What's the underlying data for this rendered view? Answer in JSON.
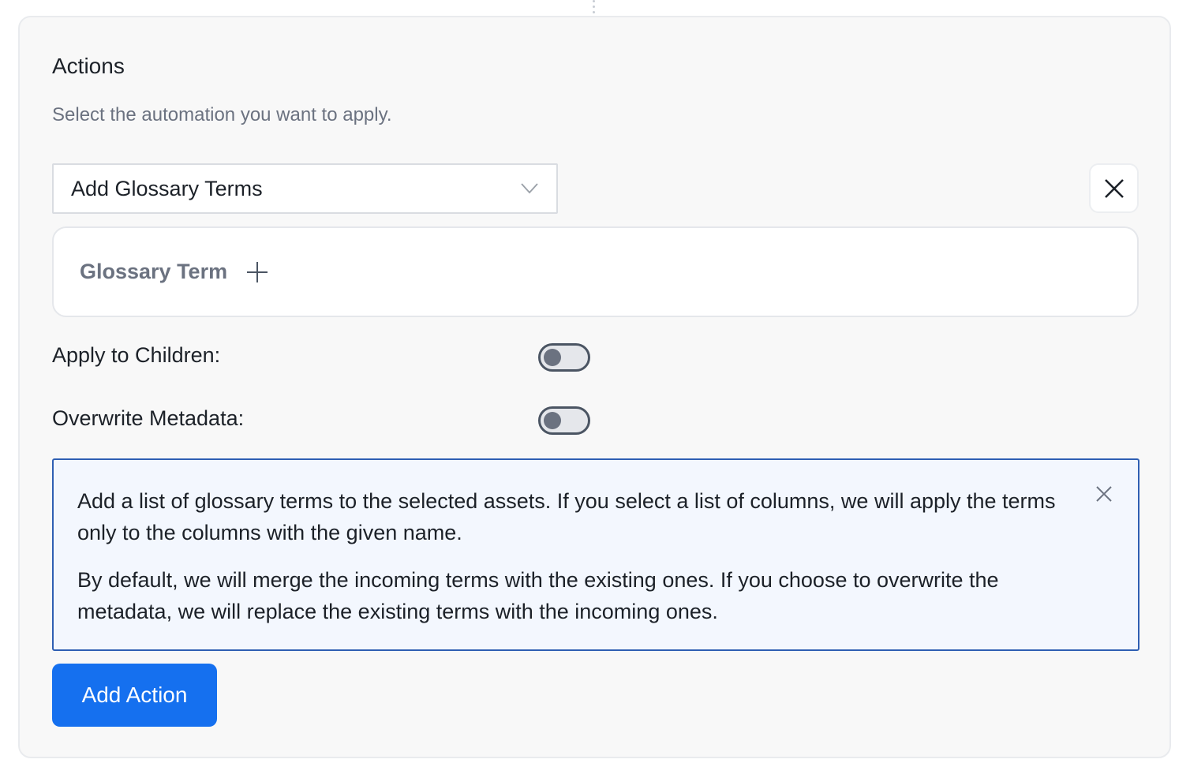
{
  "actions": {
    "title": "Actions",
    "subtitle": "Select the automation you want to apply.",
    "selected_action": "Add Glossary Terms",
    "glossary_term_label": "Glossary Term",
    "apply_to_children_label": "Apply to Children:",
    "apply_to_children_enabled": false,
    "overwrite_metadata_label": "Overwrite Metadata:",
    "overwrite_metadata_enabled": false,
    "info": {
      "paragraph1": "Add a list of glossary terms to the selected assets. If you select a list of columns, we will apply the terms only to the columns with the given name.",
      "paragraph2": "By default, we will merge the incoming terms with the existing ones. If you choose to overwrite the metadata, we will replace the existing terms with the incoming ones."
    },
    "add_action_label": "Add Action"
  },
  "icons": {
    "select_chevron": "chevron-down-icon",
    "remove": "close-icon",
    "add_term": "plus-icon",
    "alert_close": "close-icon"
  },
  "colors": {
    "primary": "#1570ef",
    "info_border": "#2f5fb3",
    "info_background": "#f3f7fe"
  }
}
